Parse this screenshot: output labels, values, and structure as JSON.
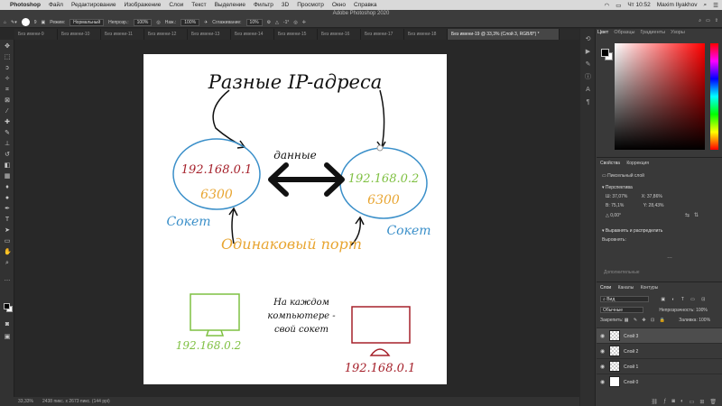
{
  "menubar": {
    "apple": "",
    "app": "Photoshop",
    "items": [
      "Файл",
      "Редактирование",
      "Изображение",
      "Слои",
      "Текст",
      "Выделение",
      "Фильтр",
      "3D",
      "Просмотр",
      "Окно",
      "Справка"
    ],
    "clock": "Чт 10:52",
    "user": "Maxim Ilyakhov"
  },
  "window": {
    "title": "Adobe Photoshop 2020"
  },
  "options": {
    "brush_size": "9",
    "mode_label": "Режим:",
    "mode_value": "Нормальный",
    "opacity_label": "Непрозр.:",
    "opacity_value": "100%",
    "press_label": "Наж.:",
    "press_value": "100%",
    "smooth_label": "Сглаживание:",
    "smooth_value": "10%",
    "angle_value": "-1°"
  },
  "tabs": [
    {
      "label": "Без имени-9"
    },
    {
      "label": "Без имени-10"
    },
    {
      "label": "Без имени-11"
    },
    {
      "label": "Без имени-12"
    },
    {
      "label": "Без имени-13"
    },
    {
      "label": "Без имени-14"
    },
    {
      "label": "Без имени-15"
    },
    {
      "label": "Без имени-16"
    },
    {
      "label": "Без имени-17"
    },
    {
      "label": "Без имени-18"
    },
    {
      "label": "Без имени-19 @ 33,3% (Слой 3, RGB/8*) *"
    }
  ],
  "drawing": {
    "title": "Разные IP-адреса",
    "data_label": "данные",
    "left_ip": "192.168.0.1",
    "left_port": "6300",
    "left_socket": "Сокет",
    "right_ip": "192.168.0.2",
    "right_port": "6300",
    "right_socket": "Сокет",
    "same_port": "Одинаковый порт",
    "note_line1": "На каждом",
    "note_line2": "компьютере -",
    "note_line3": "свой сокет",
    "green_ip": "192.168.0.2",
    "red_ip": "192.168.0.1",
    "colors": {
      "blue": "#3a8fc9",
      "red": "#a5202a",
      "orange": "#e8a531",
      "green": "#7fc042",
      "black": "#111111"
    }
  },
  "status": {
    "zoom": "33,33%",
    "doc_info": "2438 пикс. x 2673 пикс. (144 ppi)"
  },
  "color_panel": {
    "tabs": [
      "Цвет",
      "Образцы",
      "Градиенты",
      "Узоры"
    ]
  },
  "properties_panel": {
    "tabs": [
      "Свойства",
      "Коррекция"
    ],
    "layer_type": "Пиксельный слой",
    "transform_title": "Перспектива",
    "w_label": "Ш:",
    "w_value": "37,07%",
    "x_label": "X:",
    "x_value": "37,86%",
    "h_label": "В:",
    "h_value": "75,1%",
    "y_label": "Y:",
    "y_value": "28,43%",
    "angle_value": "0,00°",
    "align_title": "Выравнять и распределить",
    "align_label": "Выровнять:",
    "more_label": "Дополнительные"
  },
  "layers_panel": {
    "tabs": [
      "Слои",
      "Каналы",
      "Контуры"
    ],
    "search_placeholder": "Вид",
    "blend_mode": "Обычные",
    "opacity_label": "Непрозрачность:",
    "opacity_value": "100%",
    "lock_label": "Закрепить:",
    "fill_label": "Заливка:",
    "fill_value": "100%",
    "layers": [
      {
        "name": "Слой 3",
        "selected": true
      },
      {
        "name": "Слой 2",
        "selected": false
      },
      {
        "name": "Слой 1",
        "selected": false
      },
      {
        "name": "Слой 0",
        "selected": false
      }
    ]
  }
}
